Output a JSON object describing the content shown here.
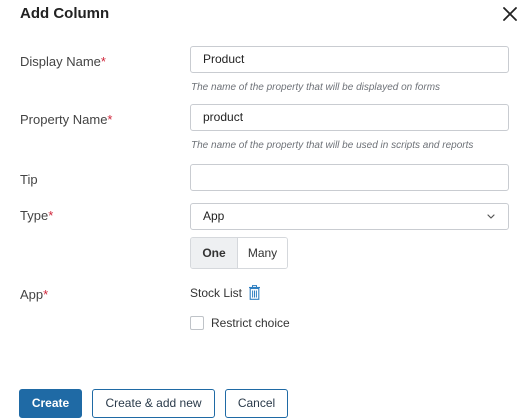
{
  "dialog": {
    "title": "Add Column",
    "close_icon": "close-icon"
  },
  "fields": {
    "display_name": {
      "label": "Display Name",
      "required_mark": "*",
      "value": "Product",
      "hint": "The name of the property that will be displayed on forms"
    },
    "property_name": {
      "label": "Property Name",
      "required_mark": "*",
      "value": "product",
      "hint": "The name of the property that will be used in scripts and reports"
    },
    "tip": {
      "label": "Tip",
      "value": ""
    },
    "type": {
      "label": "Type",
      "required_mark": "*",
      "selected": "App",
      "chevron_icon": "chevron-down-icon"
    },
    "cardinality": {
      "options": [
        "One",
        "Many"
      ],
      "selected": "One"
    },
    "app": {
      "label": "App",
      "required_mark": "*",
      "value": "Stock List",
      "trash_icon": "trash-icon"
    },
    "restrict_choice": {
      "label": "Restrict choice",
      "checked": false
    }
  },
  "footer": {
    "create_label": "Create",
    "create_add_new_label": "Create & add new",
    "cancel_label": "Cancel"
  },
  "colors": {
    "primary": "#1f6aa5",
    "required": "#d0263b",
    "trash": "#2f7fc1"
  }
}
